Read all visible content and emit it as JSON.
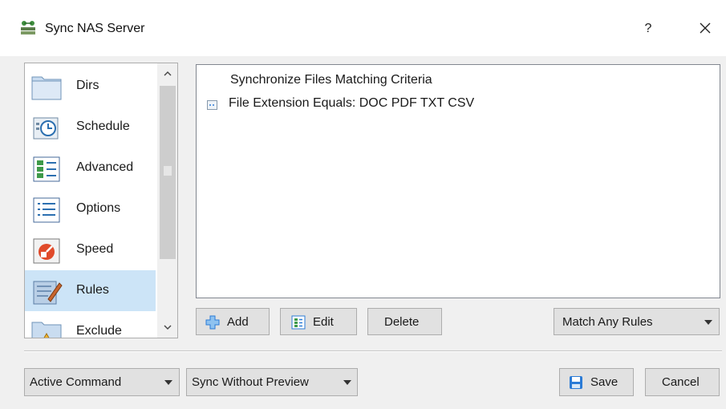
{
  "window": {
    "title": "Sync NAS Server",
    "help_label": "?",
    "icons": {
      "app": "nas-sync-icon",
      "close": "close-icon"
    }
  },
  "nav": {
    "items": [
      {
        "label": "Dirs",
        "icon": "folder-icon",
        "selected": false
      },
      {
        "label": "Schedule",
        "icon": "schedule-clock-icon",
        "selected": false
      },
      {
        "label": "Advanced",
        "icon": "advanced-list-icon",
        "selected": false
      },
      {
        "label": "Options",
        "icon": "options-list-icon",
        "selected": false
      },
      {
        "label": "Speed",
        "icon": "speed-icon",
        "selected": false
      },
      {
        "label": "Rules",
        "icon": "rules-icon",
        "selected": true
      },
      {
        "label": "Exclude",
        "icon": "exclude-icon",
        "selected": false
      }
    ]
  },
  "rules": {
    "header": "Synchronize Files Matching Criteria",
    "items": [
      {
        "text": "File Extension Equals: DOC PDF TXT CSV",
        "icon": "file-extension-rule-icon"
      }
    ]
  },
  "rule_buttons": {
    "add": "Add",
    "edit": "Edit",
    "delete": "Delete",
    "match_mode": "Match Any Rules"
  },
  "footer": {
    "command_mode": "Active Command",
    "sync_mode": "Sync Without Preview",
    "save": "Save",
    "cancel": "Cancel"
  },
  "colors": {
    "selection": "#cce4f7",
    "accent_blue": "#2b7bd6"
  }
}
